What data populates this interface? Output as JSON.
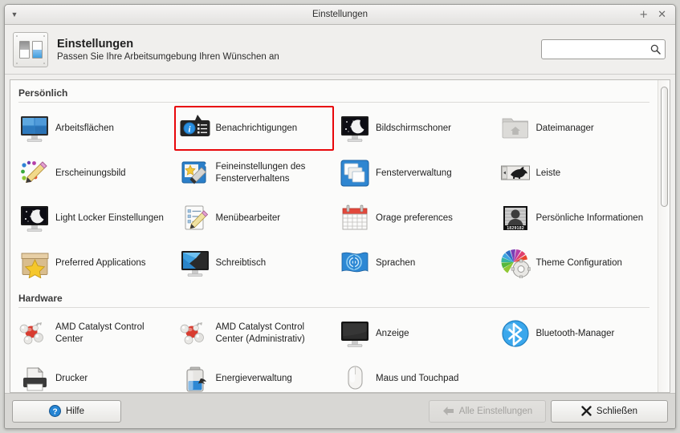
{
  "window": {
    "title": "Einstellungen",
    "menu_icon": "chevron-down-icon",
    "maximize_icon": "maximize-icon",
    "close_icon": "close-icon"
  },
  "header": {
    "title": "Einstellungen",
    "subtitle": "Passen Sie Ihre Arbeitsumgebung Ihren Wünschen an",
    "app_icon": "settings-sliders-icon"
  },
  "search": {
    "value": "",
    "placeholder": "",
    "icon": "search-icon"
  },
  "sections": [
    {
      "title": "Persönlich",
      "items": [
        {
          "label": "Arbeitsflächen",
          "icon": "workspaces-monitor-icon",
          "selected": false
        },
        {
          "label": "Benachrichtigungen",
          "icon": "notification-bubble-icon",
          "selected": true
        },
        {
          "label": "Bildschirmschoner",
          "icon": "screensaver-moon-icon",
          "selected": false
        },
        {
          "label": "Dateimanager",
          "icon": "file-manager-folder-icon",
          "selected": false
        },
        {
          "label": "Erscheinungsbild",
          "icon": "appearance-pencil-icon",
          "selected": false
        },
        {
          "label": "Feineinstellungen des Fensterverhaltens",
          "icon": "window-tweaks-wand-icon",
          "selected": false
        },
        {
          "label": "Fensterverwaltung",
          "icon": "window-manager-icon",
          "selected": false
        },
        {
          "label": "Leiste",
          "icon": "panel-mouse-icon",
          "selected": false
        },
        {
          "label": "Light Locker Einstellungen",
          "icon": "light-locker-moon-icon",
          "selected": false
        },
        {
          "label": "Menübearbeiter",
          "icon": "menu-editor-icon",
          "selected": false
        },
        {
          "label": "Orage preferences",
          "icon": "calendar-icon",
          "selected": false
        },
        {
          "label": "Persönliche Informationen",
          "icon": "user-mugshot-icon",
          "selected": false
        },
        {
          "label": "Preferred Applications",
          "icon": "preferred-apps-star-icon",
          "selected": false
        },
        {
          "label": "Schreibtisch",
          "icon": "desktop-monitor-icon",
          "selected": false
        },
        {
          "label": "Sprachen",
          "icon": "languages-flag-icon",
          "selected": false
        },
        {
          "label": "Theme Configuration",
          "icon": "theme-config-gear-icon",
          "selected": false
        }
      ]
    },
    {
      "title": "Hardware",
      "items": [
        {
          "label": "AMD Catalyst Control Center",
          "icon": "amd-catalyst-molecule-icon",
          "selected": false
        },
        {
          "label": "AMD Catalyst Control Center (Administrativ)",
          "icon": "amd-catalyst-molecule-icon",
          "selected": false
        },
        {
          "label": "Anzeige",
          "icon": "display-monitor-icon",
          "selected": false
        },
        {
          "label": "Bluetooth-Manager",
          "icon": "bluetooth-icon",
          "selected": false
        },
        {
          "label": "Drucker",
          "icon": "printer-icon",
          "selected": false
        },
        {
          "label": "Energieverwaltung",
          "icon": "battery-power-icon",
          "selected": false
        },
        {
          "label": "Maus und Touchpad",
          "icon": "mouse-icon",
          "selected": false
        }
      ]
    }
  ],
  "person_icon_number": "1829182",
  "buttons": {
    "help": {
      "label": "Hilfe",
      "icon": "help-question-icon",
      "enabled": true
    },
    "all_settings": {
      "label": "Alle Einstellungen",
      "icon": "back-arrow-icon",
      "enabled": false
    },
    "close": {
      "label": "Schließen",
      "icon": "close-x-icon",
      "enabled": true
    }
  },
  "colors": {
    "selection_outline": "#e8070a",
    "window_bg": "#f0efed",
    "content_bg": "#fbfbfa",
    "button_bar_bg": "#d8d7d4"
  }
}
